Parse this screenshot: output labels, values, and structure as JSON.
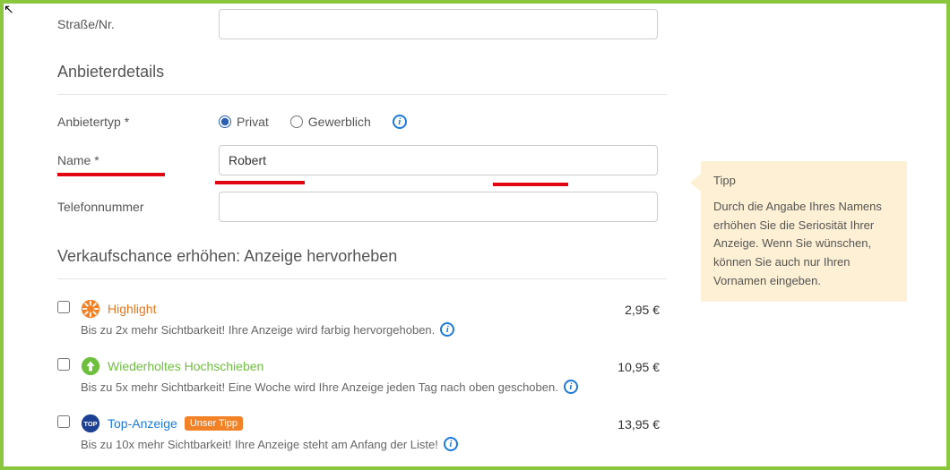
{
  "address": {
    "street_label": "Straße/Nr.",
    "street_value": ""
  },
  "seller": {
    "heading": "Anbieterdetails",
    "type_label": "Anbietertyp *",
    "type_options": {
      "private": "Privat",
      "commercial": "Gewerblich"
    },
    "name_label": "Name *",
    "name_value": "Robert",
    "phone_label": "Telefonnummer",
    "phone_value": ""
  },
  "tip": {
    "title": "Tipp",
    "body": "Durch die Angabe Ihres Namens erhöhen Sie die Seriosität Ihrer Anzeige. Wenn Sie wünschen, können Sie auch nur Ihren Vornamen eingeben."
  },
  "promote": {
    "heading": "Verkaufschance erhöhen: Anzeige hervorheben",
    "items": [
      {
        "icon": "highlight",
        "title": "Highlight",
        "title_color": "#e8761e",
        "desc": "Bis zu 2x mehr Sichtbarkeit! Ihre Anzeige wird farbig hervorgehoben.",
        "price": "2,95 €"
      },
      {
        "icon": "bump",
        "title": "Wiederholtes Hochschieben",
        "title_color": "#6fbf3f",
        "desc": "Bis zu 5x mehr Sichtbarkeit! Eine Woche wird Ihre Anzeige jeden Tag nach oben geschoben.",
        "price": "10,95 €"
      },
      {
        "icon": "top",
        "title": "Top-Anzeige",
        "title_color": "#1d7ad9",
        "badge": "Unser Tipp",
        "desc": "Bis zu 10x mehr Sichtbarkeit! Ihre Anzeige steht am Anfang der Liste!",
        "price": "13,95 €"
      }
    ]
  }
}
